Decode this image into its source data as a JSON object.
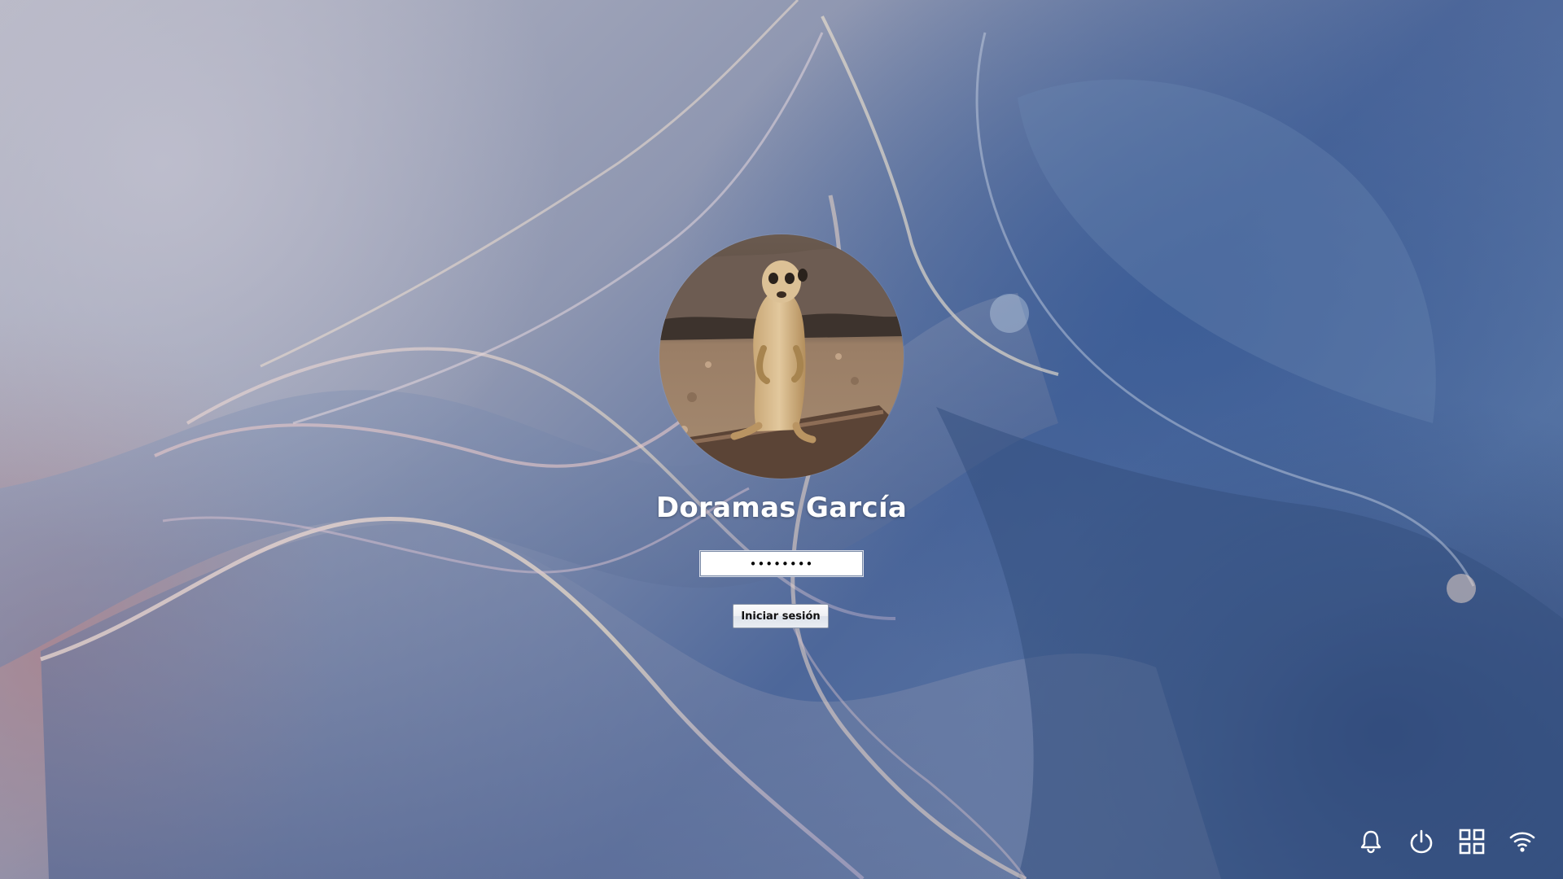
{
  "user": {
    "name": "Doramas García",
    "avatar_description": "meerkat"
  },
  "password_field": {
    "value": "••••••••",
    "masked": true
  },
  "login_button": {
    "label": "Iniciar sesión"
  },
  "tray": {
    "icons": [
      "bell-icon",
      "power-icon",
      "grid-icon",
      "wifi-icon"
    ]
  },
  "colors": {
    "background_primary": "#4d679a",
    "text": "#ffffff"
  }
}
